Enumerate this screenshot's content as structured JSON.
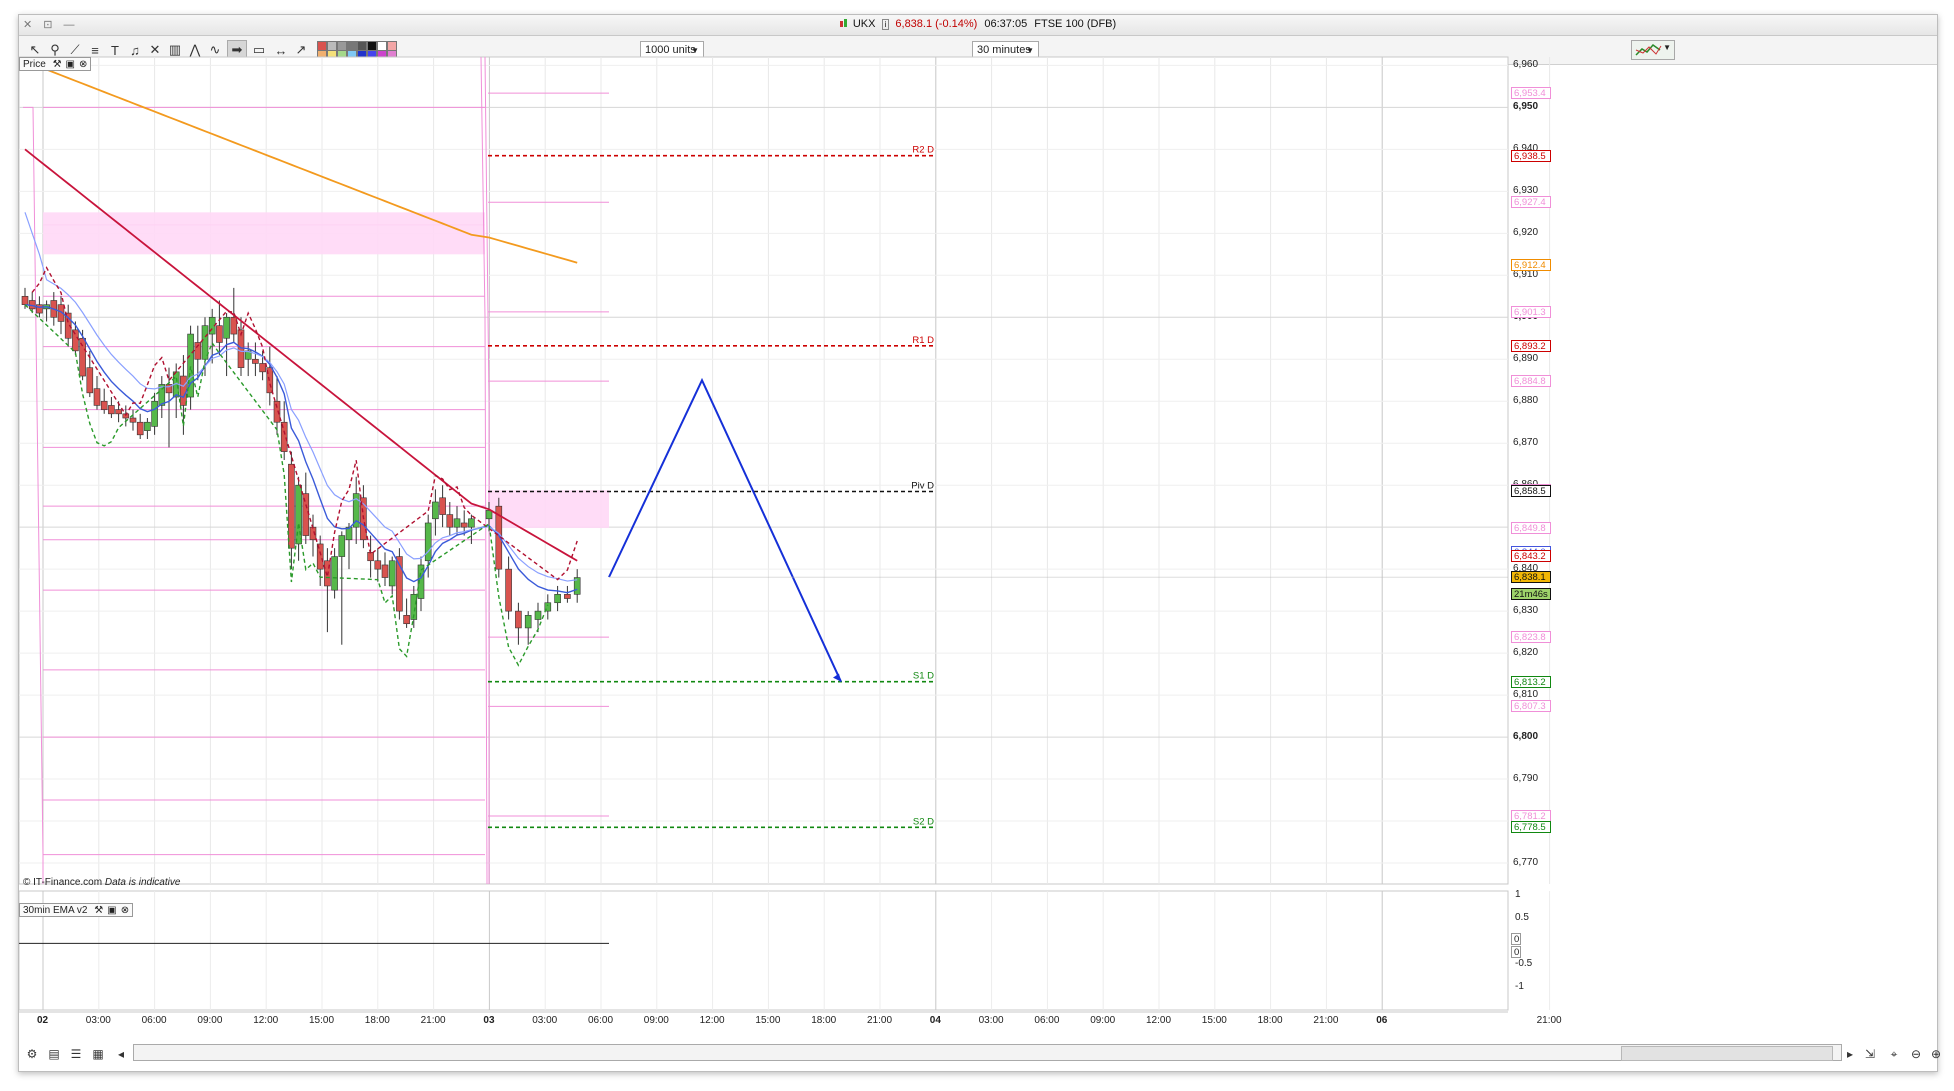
{
  "window": {
    "title_symbol": "UKX",
    "title_price": "6,838.1 (-0.14%)",
    "title_time": "06:37:05",
    "title_name": "FTSE 100 (DFB)",
    "window_controls": "✕ ⊡ —"
  },
  "toolbar": {
    "units_value": "1000 units",
    "timeframe_value": "30 minutes",
    "swatch_colors": [
      "#d9534f",
      "#bbbbbb",
      "#999999",
      "#777777",
      "#555555",
      "#111111",
      "#ffffff",
      "#f3a6a6",
      "#f0b070",
      "#f4e07a",
      "#a5d88a",
      "#7fc8f5",
      "#2233cc",
      "#4444ee",
      "#cc44cc",
      "#e07fd0"
    ]
  },
  "price_panel": {
    "label": "Price",
    "credit": "© IT-Finance.com",
    "credit_note": "Data is indicative"
  },
  "indicator_panel": {
    "label": "30min EMA v2",
    "axis_ticks": [
      "1",
      "0.5",
      "0",
      "-0.5",
      "-1"
    ],
    "box_values": [
      "0",
      "0"
    ]
  },
  "price_axis": {
    "ticks": [
      {
        "v": 6960,
        "t": "6,960",
        "bold": false
      },
      {
        "v": 6950,
        "t": "6,950",
        "bold": true
      },
      {
        "v": 6940,
        "t": "6,940",
        "bold": false
      },
      {
        "v": 6930,
        "t": "6,930",
        "bold": false
      },
      {
        "v": 6920,
        "t": "6,920",
        "bold": false
      },
      {
        "v": 6910,
        "t": "6,910",
        "bold": false
      },
      {
        "v": 6900,
        "t": "6,900",
        "bold": true
      },
      {
        "v": 6890,
        "t": "6,890",
        "bold": false
      },
      {
        "v": 6880,
        "t": "6,880",
        "bold": false
      },
      {
        "v": 6870,
        "t": "6,870",
        "bold": false
      },
      {
        "v": 6860,
        "t": "6,860",
        "bold": false
      },
      {
        "v": 6850,
        "t": "6,850",
        "bold": true
      },
      {
        "v": 6840,
        "t": "6,840",
        "bold": false
      },
      {
        "v": 6830,
        "t": "6,830",
        "bold": false
      },
      {
        "v": 6820,
        "t": "6,820",
        "bold": false
      },
      {
        "v": 6810,
        "t": "6,810",
        "bold": false
      },
      {
        "v": 6800,
        "t": "6,800",
        "bold": true
      },
      {
        "v": 6790,
        "t": "6,790",
        "bold": false
      },
      {
        "v": 6780,
        "t": "6,780",
        "bold": false
      },
      {
        "v": 6770,
        "t": "6,770",
        "bold": false
      }
    ],
    "boxes": [
      {
        "v": 6953.4,
        "t": "6,953.4",
        "color": "#f08fd8"
      },
      {
        "v": 6938.5,
        "t": "6,938.5",
        "color": "#cc0000"
      },
      {
        "v": 6927.4,
        "t": "6,927.4",
        "color": "#f08fd8"
      },
      {
        "v": 6912.4,
        "t": "6,912.4",
        "color": "#f08c00"
      },
      {
        "v": 6901.3,
        "t": "6,901.3",
        "color": "#f08fd8"
      },
      {
        "v": 6893.2,
        "t": "6,893.2",
        "color": "#cc0000"
      },
      {
        "v": 6884.8,
        "t": "6,884.8",
        "color": "#f08fd8"
      },
      {
        "v": 6858.8,
        "t": "6,858.8",
        "color": "#f08fd8"
      },
      {
        "v": 6858.5,
        "t": "6,858.5",
        "color": "#111111"
      },
      {
        "v": 6849.8,
        "t": "6,849.8",
        "color": "#f08fd8"
      },
      {
        "v": 6844.0,
        "t": "6,844.0",
        "color": "#4455dd"
      },
      {
        "v": 6843.2,
        "t": "6,843.2",
        "color": "#cc0000"
      },
      {
        "v": 6838.1,
        "t": "6,838.1",
        "color": "#111111",
        "fill": "#f2b705"
      },
      {
        "v": 6834.0,
        "t": "21m46s",
        "color": "#111111",
        "fill": "#9ed36a"
      },
      {
        "v": 6823.8,
        "t": "6,823.8",
        "color": "#f08fd8"
      },
      {
        "v": 6813.2,
        "t": "6,813.2",
        "color": "#118811"
      },
      {
        "v": 6807.3,
        "t": "6,807.3",
        "color": "#f08fd8"
      },
      {
        "v": 6781.2,
        "t": "6,781.2",
        "color": "#f08fd8"
      },
      {
        "v": 6778.5,
        "t": "6,778.5",
        "color": "#118811"
      }
    ]
  },
  "pivots": [
    {
      "label": "R2 D",
      "v": 6938.5,
      "color": "#cc0000"
    },
    {
      "label": "R1 D",
      "v": 6893.2,
      "color": "#cc0000"
    },
    {
      "label": "Piv D",
      "v": 6858.5,
      "color": "#111111"
    },
    {
      "label": "S1 D",
      "v": 6813.2,
      "color": "#118811"
    },
    {
      "label": "S2 D",
      "v": 6778.5,
      "color": "#118811"
    }
  ],
  "time_axis": {
    "labels": [
      {
        "t": "02",
        "bold": true
      },
      {
        "t": "03:00",
        "bold": false
      },
      {
        "t": "06:00",
        "bold": false
      },
      {
        "t": "09:00",
        "bold": false
      },
      {
        "t": "12:00",
        "bold": false
      },
      {
        "t": "15:00",
        "bold": false
      },
      {
        "t": "18:00",
        "bold": false
      },
      {
        "t": "21:00",
        "bold": false
      },
      {
        "t": "03",
        "bold": true
      },
      {
        "t": "03:00",
        "bold": false
      },
      {
        "t": "06:00",
        "bold": false
      },
      {
        "t": "09:00",
        "bold": false
      },
      {
        "t": "12:00",
        "bold": false
      },
      {
        "t": "15:00",
        "bold": false
      },
      {
        "t": "18:00",
        "bold": false
      },
      {
        "t": "21:00",
        "bold": false
      },
      {
        "t": "04",
        "bold": true
      },
      {
        "t": "03:00",
        "bold": false
      },
      {
        "t": "06:00",
        "bold": false
      },
      {
        "t": "09:00",
        "bold": false
      },
      {
        "t": "12:00",
        "bold": false
      },
      {
        "t": "15:00",
        "bold": false
      },
      {
        "t": "18:00",
        "bold": false
      },
      {
        "t": "21:00",
        "bold": false
      },
      {
        "t": "06",
        "bold": true
      },
      {
        "t": "21:00",
        "bold": false
      }
    ]
  },
  "chart_data": {
    "type": "candlestick",
    "symbol": "UKX",
    "timeframe": "30 minutes",
    "ylim": [
      6765,
      6962
    ],
    "candles": [
      [
        6905,
        6907,
        6902,
        6903
      ],
      [
        6904,
        6906,
        6901,
        6902
      ],
      [
        6903,
        6905,
        6900,
        6901
      ],
      [
        6902,
        6904,
        6899,
        6903
      ],
      [
        6904,
        6906,
        6898,
        6900
      ],
      [
        6903,
        6905,
        6896,
        6899
      ],
      [
        6901,
        6903,
        6893,
        6895
      ],
      [
        6897,
        6899,
        6891,
        6892
      ],
      [
        6895,
        6897,
        6885,
        6886
      ],
      [
        6888,
        6892,
        6881,
        6882
      ],
      [
        6883,
        6886,
        6878,
        6879
      ],
      [
        6880,
        6883,
        6877,
        6878
      ],
      [
        6879,
        6881,
        6876,
        6877
      ],
      [
        6878,
        6880,
        6875,
        6877
      ],
      [
        6877,
        6879,
        6874,
        6876
      ],
      [
        6876,
        6878,
        6873,
        6875
      ],
      [
        6875,
        6877,
        6871,
        6872
      ],
      [
        6873,
        6876,
        6871,
        6875
      ],
      [
        6874,
        6882,
        6872,
        6880
      ],
      [
        6879,
        6886,
        6876,
        6884
      ],
      [
        6884,
        6888,
        6869,
        6882
      ],
      [
        6881,
        6889,
        6876,
        6887
      ],
      [
        6886,
        6891,
        6872,
        6879
      ],
      [
        6881,
        6898,
        6878,
        6896
      ],
      [
        6894,
        6898,
        6885,
        6890
      ],
      [
        6890,
        6900,
        6886,
        6898
      ],
      [
        6896,
        6902,
        6889,
        6900
      ],
      [
        6898,
        6904,
        6891,
        6894
      ],
      [
        6895,
        6901,
        6886,
        6900
      ],
      [
        6900,
        6907,
        6894,
        6896
      ],
      [
        6897,
        6900,
        6886,
        6888
      ],
      [
        6890,
        6894,
        6886,
        6892
      ],
      [
        6890,
        6894,
        6886,
        6889
      ],
      [
        6889,
        6892,
        6885,
        6887
      ],
      [
        6888,
        6893,
        6879,
        6882
      ],
      [
        6880,
        6886,
        6872,
        6875
      ],
      [
        6875,
        6880,
        6866,
        6868
      ],
      [
        6865,
        6868,
        6840,
        6845
      ],
      [
        6846,
        6862,
        6842,
        6860
      ],
      [
        6858,
        6863,
        6846,
        6848
      ],
      [
        6850,
        6853,
        6843,
        6847
      ],
      [
        6846,
        6848,
        6836,
        6840
      ],
      [
        6842,
        6845,
        6825,
        6836
      ],
      [
        6835,
        6845,
        6833,
        6843
      ],
      [
        6843,
        6849,
        6822,
        6848
      ],
      [
        6847,
        6851,
        6840,
        6850
      ],
      [
        6850,
        6862,
        6846,
        6858
      ],
      [
        6857,
        6860,
        6845,
        6847
      ],
      [
        6844,
        6848,
        6838,
        6842
      ],
      [
        6842,
        6845,
        6837,
        6840
      ],
      [
        6841,
        6844,
        6836,
        6838
      ],
      [
        6836,
        6843,
        6834,
        6842
      ],
      [
        6843,
        6845,
        6828,
        6830
      ],
      [
        6829,
        6833,
        6826,
        6827
      ],
      [
        6828,
        6836,
        6826,
        6834
      ],
      [
        6833,
        6843,
        6830,
        6841
      ],
      [
        6842,
        6853,
        6838,
        6851
      ],
      [
        6852,
        6859,
        6848,
        6856
      ],
      [
        6857,
        6860,
        6850,
        6853
      ],
      [
        6853,
        6856,
        6848,
        6850
      ],
      [
        6850,
        6855,
        6848,
        6852
      ],
      [
        6851,
        6854,
        6848,
        6850
      ],
      [
        6850,
        6853,
        6846,
        6852
      ],
      [
        6852,
        6856,
        6849,
        6854
      ],
      [
        6855,
        6857,
        6838,
        6840
      ],
      [
        6840,
        6843,
        6828,
        6830
      ],
      [
        6830,
        6832,
        6822,
        6826
      ],
      [
        6826,
        6830,
        6822,
        6829
      ],
      [
        6828,
        6832,
        6825,
        6830
      ],
      [
        6830,
        6834,
        6828,
        6832
      ],
      [
        6832,
        6836,
        6830,
        6834
      ],
      [
        6834,
        6836,
        6832,
        6833
      ],
      [
        6834,
        6840,
        6832,
        6838
      ]
    ],
    "projection": [
      [
        6838.1,
        "06:30"
      ],
      [
        6885,
        "11:30"
      ],
      [
        6813.2,
        "18:30"
      ]
    ]
  }
}
